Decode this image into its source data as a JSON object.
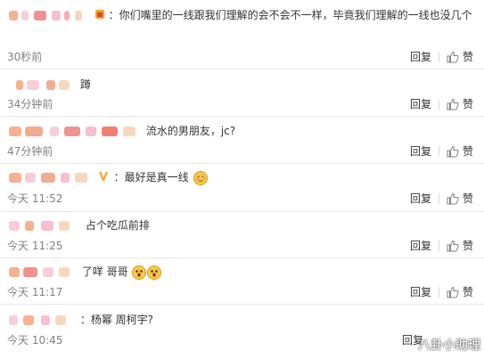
{
  "comments": [
    {
      "text": "：你们嘴里的一线跟我们理解的会不会不一样，毕竟我们理解的一线也没几个",
      "time": "30秒前"
    },
    {
      "text": "蹲",
      "time": "34分钟前"
    },
    {
      "text": "流水的男朋友，jc?",
      "time": "47分钟前"
    },
    {
      "text": "：最好是真一线",
      "time": "今天 11:52"
    },
    {
      "text": "占个吃瓜前排",
      "time": "今天 11:25"
    },
    {
      "text": "了咩 哥哥",
      "time": "今天 11:17"
    },
    {
      "text": "：杨幂 周柯宇?",
      "time": "今天 10:45"
    }
  ],
  "actions": {
    "reply": "回复",
    "like": "赞"
  },
  "watermark": "八卦小助理"
}
